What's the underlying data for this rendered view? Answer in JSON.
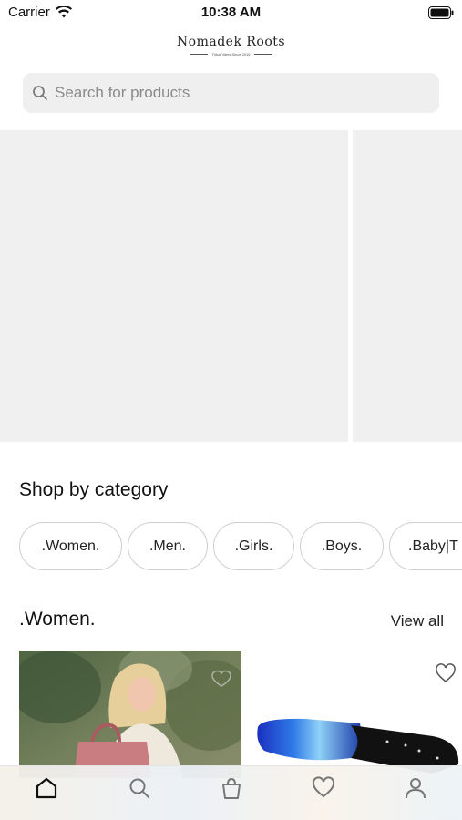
{
  "status": {
    "carrier": "Carrier",
    "time": "10:38 AM"
  },
  "brand": {
    "name": "Nomadek Roots",
    "tagline": "Tribal Vibes Since 2015"
  },
  "search": {
    "placeholder": "Search for products"
  },
  "categories": {
    "title": "Shop by category",
    "items": [
      ".Women.",
      ".Men.",
      ".Girls.",
      ".Boys.",
      ".Baby|T"
    ]
  },
  "women_section": {
    "title": ".Women.",
    "view_all": "View all"
  },
  "tabs": [
    "home-icon",
    "search-icon",
    "bag-icon",
    "heart-icon",
    "profile-icon"
  ],
  "colors": {
    "background": "#ffffff",
    "search_bg": "#efefef",
    "banner_placeholder": "#f0f0f0",
    "chip_border": "#cfcfcf"
  }
}
